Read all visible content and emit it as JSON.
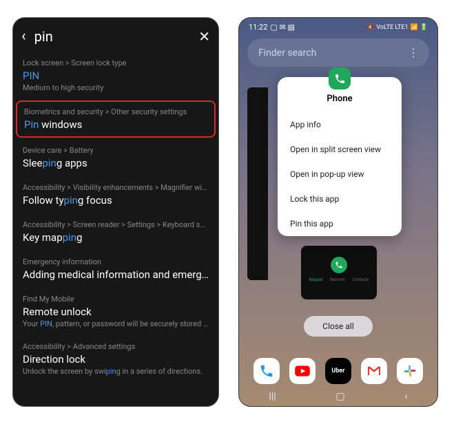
{
  "left": {
    "search_query": "pin",
    "results": [
      {
        "breadcrumb": "Lock screen > Screen lock type",
        "title_parts": [
          "",
          "PIN",
          ""
        ],
        "subtitle": "Medium to high security",
        "highlighted": false
      },
      {
        "breadcrumb": "Biometrics and security > Other security settings",
        "title_parts": [
          "",
          "Pin",
          " windows"
        ],
        "subtitle": "",
        "highlighted": true
      },
      {
        "breadcrumb": "Device care > Battery",
        "title_parts": [
          "Slee",
          "pin",
          "g apps"
        ],
        "subtitle": "",
        "highlighted": false
      },
      {
        "breadcrumb": "Accessibility > Visibility enhancements > Magnifier win…",
        "title_parts": [
          "Follow ty",
          "pin",
          "g focus"
        ],
        "subtitle": "",
        "highlighted": false
      },
      {
        "breadcrumb": "Accessibility > Screen reader > Settings > Keyboard sh…",
        "title_parts": [
          "Key map",
          "pin",
          "g"
        ],
        "subtitle": "",
        "highlighted": false
      },
      {
        "breadcrumb": "Emergency information",
        "title_parts": [
          "Adding medical information and emerg…",
          "",
          ""
        ],
        "subtitle": "",
        "highlighted": false
      },
      {
        "breadcrumb": "Find My Mobile",
        "title_parts": [
          "Remote unlock",
          "",
          ""
        ],
        "subtitle_parts": [
          "Your ",
          "PIN",
          ", pattern, or password will be securely stored b…"
        ],
        "highlighted": false
      },
      {
        "breadcrumb": "Accessibility > Advanced settings",
        "title_parts": [
          "Direction lock",
          "",
          ""
        ],
        "subtitle_parts": [
          "Unlock the screen by swi",
          "pin",
          "g in a series of directions."
        ],
        "highlighted": false
      }
    ]
  },
  "right": {
    "time": "11:22",
    "status_right": "VoLTE LTE1",
    "finder_placeholder": "Finder search",
    "context": {
      "app_name": "Phone",
      "items": [
        "App info",
        "Open in split screen view",
        "Open in pop-up view",
        "Lock this app",
        "Pin this app"
      ]
    },
    "mini_tabs": [
      "Keypad",
      "Recents",
      "Contacts"
    ],
    "close_all": "Close all",
    "dock": {
      "uber": "Uber"
    }
  }
}
